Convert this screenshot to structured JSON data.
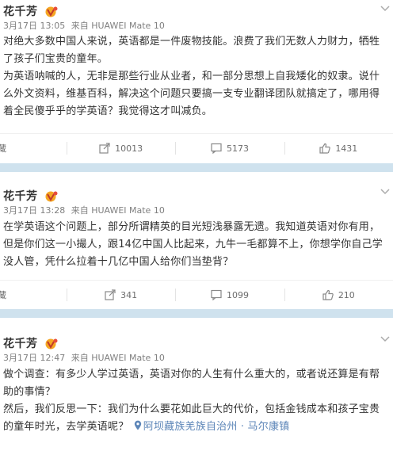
{
  "posts": [
    {
      "author": "花千芳",
      "date": "3月17日 13:05",
      "source": "来自 HUAWEI Mate 10",
      "paragraphs": [
        "对绝大多数中国人来说，英语都是一件废物技能。浪费了我们无数人力财力，牺牲了孩子们宝贵的童年。",
        "为英语呐喊的人，无非是那些行业从业者，和一部分思想上自我矮化的奴隶。说什么外文资料，维基百科，解决这个问题只要搞一支专业翻译团队就搞定了，哪用得着全民傻乎乎的学英语？我觉得这才叫减负。"
      ],
      "favorite_label": "收藏",
      "reposts": "10013",
      "comments": "5173",
      "likes": "1431"
    },
    {
      "author": "花千芳",
      "date": "3月17日 13:28",
      "source": "来自 HUAWEI Mate 10",
      "paragraphs": [
        "在学英语这个问题上，部分所谓精英的目光短浅暴露无遗。我知道英语对你有用，但是你们这一小撮人，跟14亿中国人比起来，九牛一毛都算不上，你想学你自己学没人管，凭什么拉着十几亿中国人给你们当垫背？"
      ],
      "favorite_label": "收藏",
      "reposts": "341",
      "comments": "1099",
      "likes": "210"
    },
    {
      "author": "花千芳",
      "date": "3月17日 12:47",
      "source": "来自 HUAWEI Mate 10",
      "paragraphs": [
        "做个调查：有多少人学过英语，英语对你的人生有什么重大的，或者说还算是有帮助的事情？",
        "然后，我们反思一下：我们为什么要花如此巨大的代价，包括金钱成本和孩子宝贵的童年时光，去学英语呢？"
      ],
      "location": "阿坝藏族羌族自治州 · 马尔康镇"
    }
  ],
  "colors": {
    "separator": "#cfe2ee",
    "link": "#5d86b8",
    "vip": "#f5a623"
  }
}
